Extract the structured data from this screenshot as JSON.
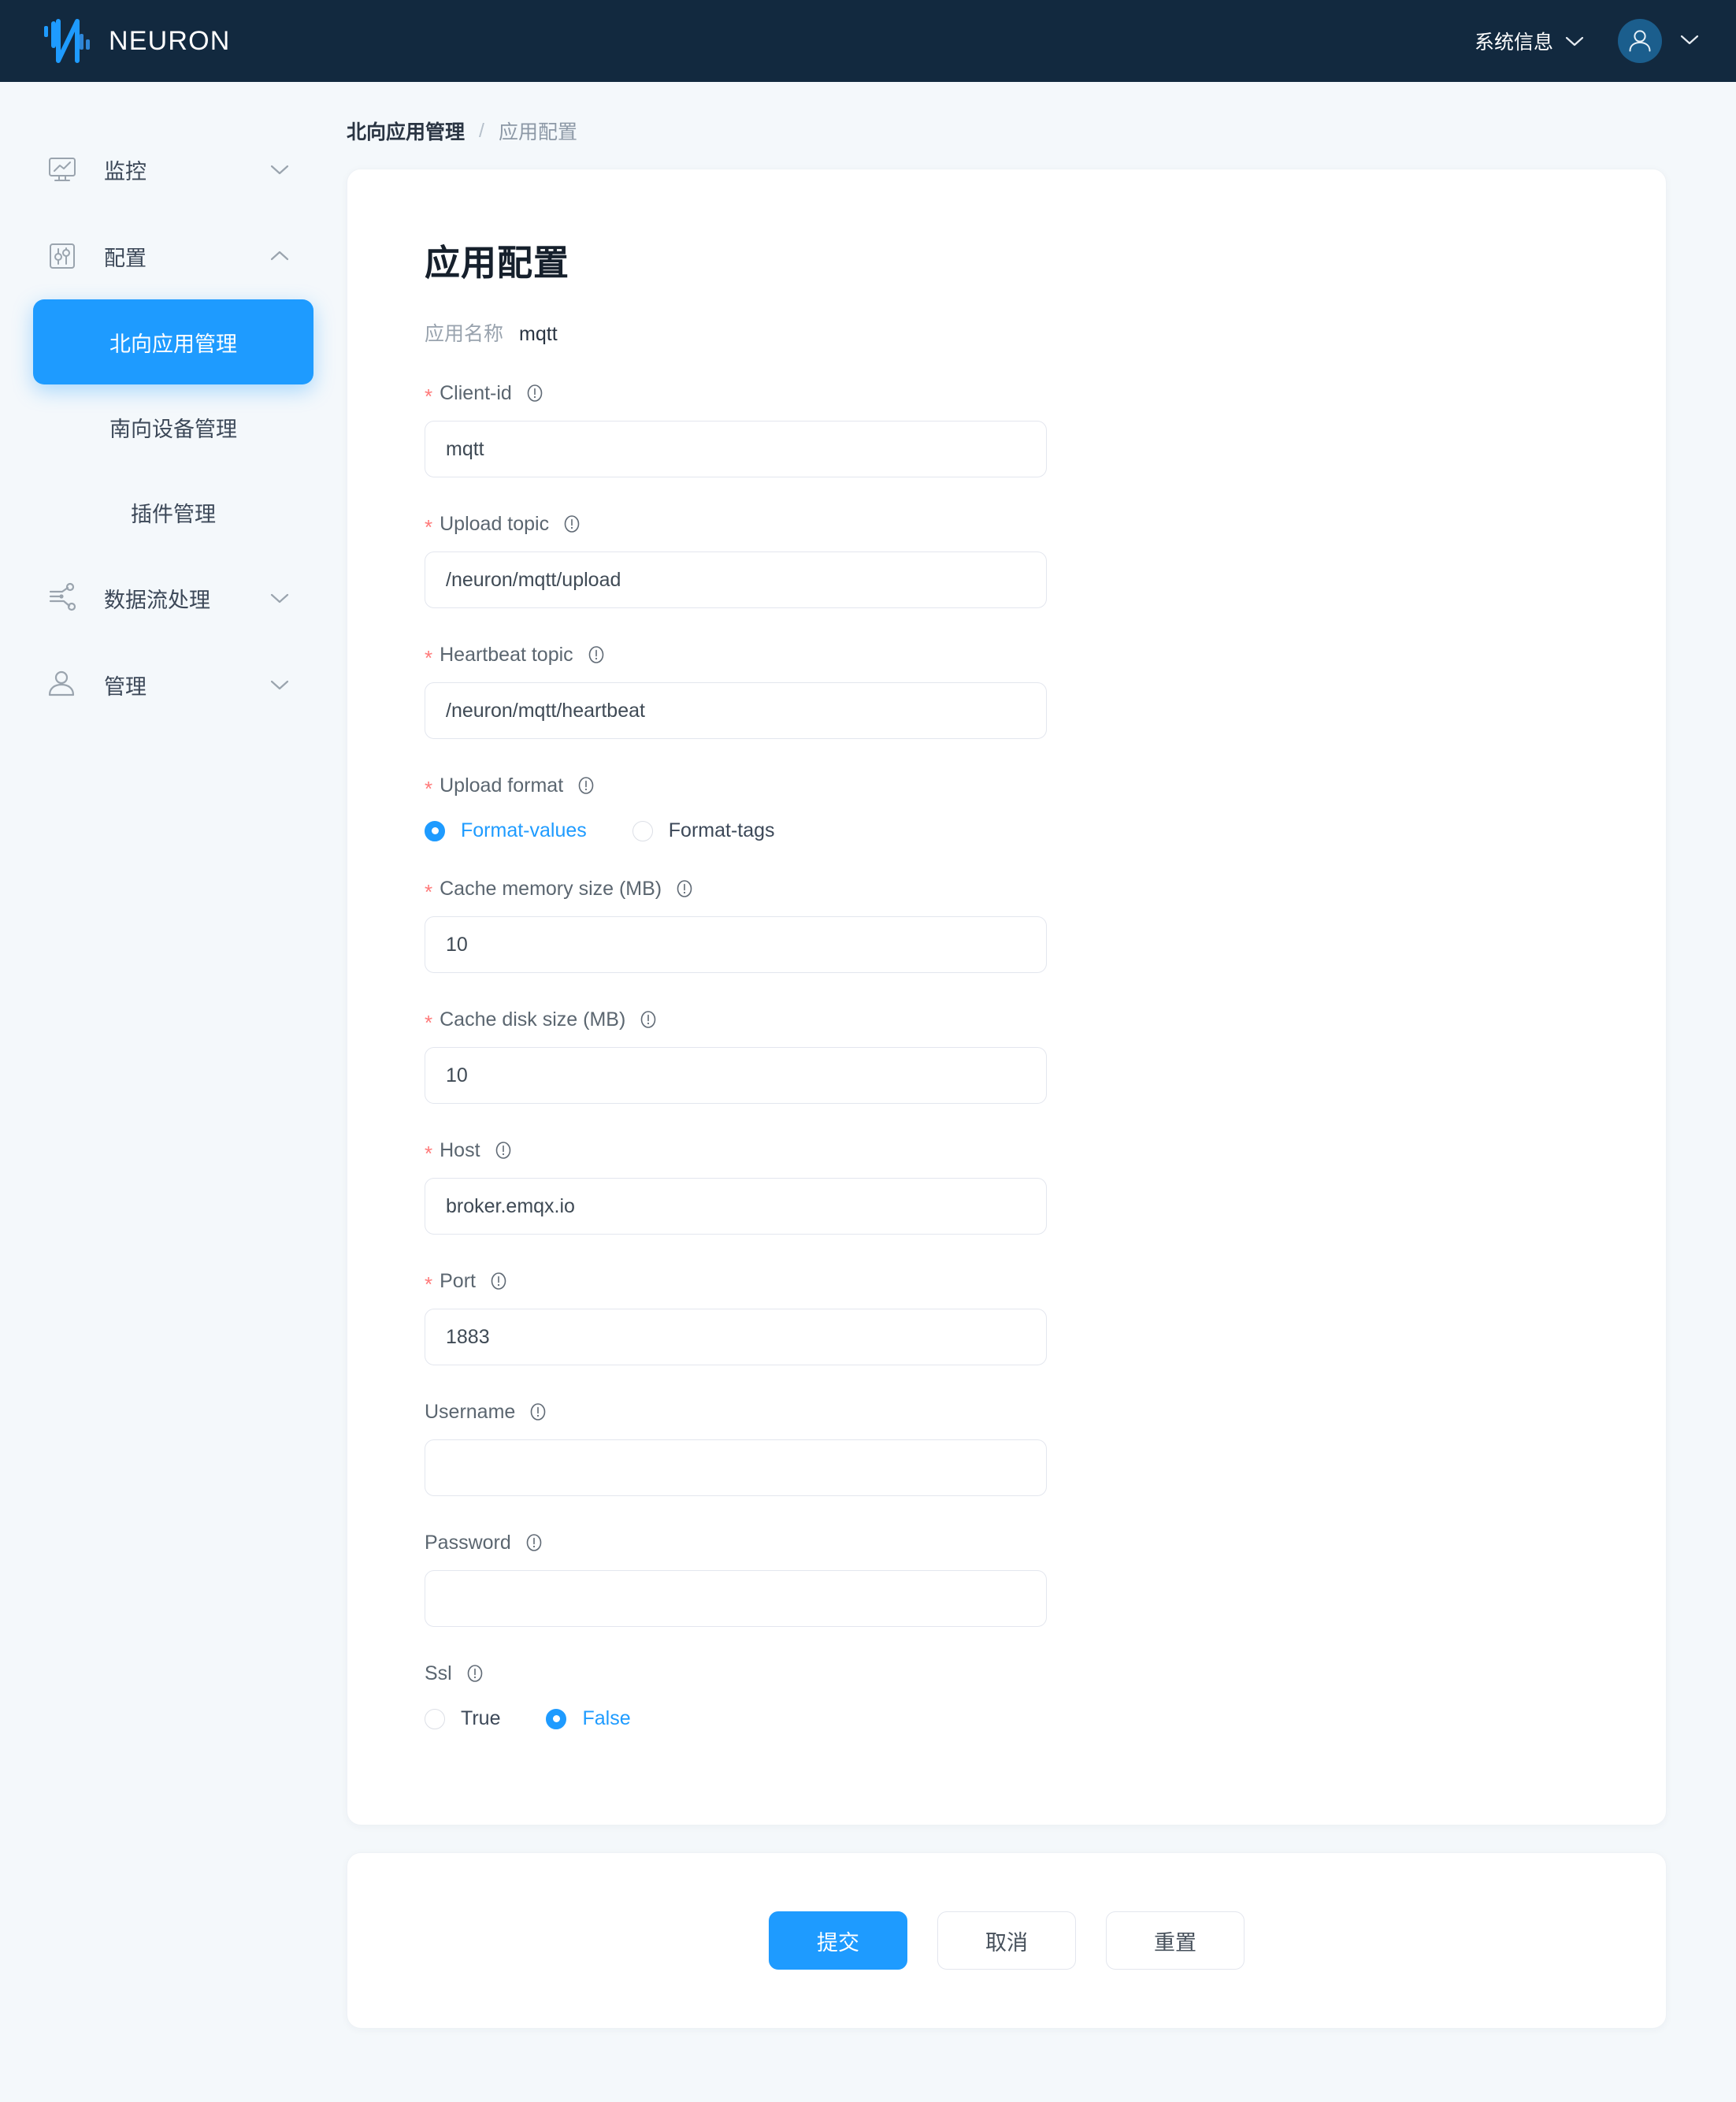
{
  "header": {
    "brand": "NEURON",
    "logo_icon": "neuron-logo-icon",
    "system_info_label": "系统信息",
    "system_info_caret_icon": "chevron-down-icon",
    "avatar_icon": "user-avatar-icon",
    "avatar_caret_icon": "chevron-down-icon"
  },
  "sidebar": {
    "groups": [
      {
        "label": "监控",
        "icon": "monitor-chart-icon",
        "caret": "chevron-down-icon",
        "expanded": false,
        "items": []
      },
      {
        "label": "配置",
        "icon": "sliders-settings-icon",
        "caret": "chevron-up-icon",
        "expanded": true,
        "items": [
          {
            "label": "北向应用管理",
            "active": true
          },
          {
            "label": "南向设备管理",
            "active": false
          },
          {
            "label": "插件管理",
            "active": false
          }
        ]
      },
      {
        "label": "数据流处理",
        "icon": "data-flow-icon",
        "caret": "chevron-down-icon",
        "expanded": false,
        "items": []
      },
      {
        "label": "管理",
        "icon": "user-person-icon",
        "caret": "chevron-down-icon",
        "expanded": false,
        "items": []
      }
    ]
  },
  "breadcrumb": {
    "parent": "北向应用管理",
    "separator": "/",
    "current": "应用配置"
  },
  "main": {
    "page_title": "应用配置",
    "app_name_label": "应用名称",
    "app_name_value": "mqtt",
    "fields": [
      {
        "key": "client_id",
        "label": "Client-id",
        "required": true,
        "type": "text",
        "value": "mqtt",
        "placeholder": "",
        "info_icon": "info-circle-icon"
      },
      {
        "key": "upload_topic",
        "label": "Upload topic",
        "required": true,
        "type": "text",
        "value": "/neuron/mqtt/upload",
        "placeholder": "",
        "info_icon": "info-circle-icon"
      },
      {
        "key": "heartbeat_topic",
        "label": "Heartbeat topic",
        "required": true,
        "type": "text",
        "value": "/neuron/mqtt/heartbeat",
        "placeholder": "",
        "info_icon": "info-circle-icon"
      },
      {
        "key": "upload_format",
        "label": "Upload format",
        "required": true,
        "type": "radio",
        "info_icon": "info-circle-icon",
        "options": [
          {
            "label": "Format-values",
            "selected": true
          },
          {
            "label": "Format-tags",
            "selected": false
          }
        ]
      },
      {
        "key": "cache_memory_size",
        "label": "Cache memory size (MB)",
        "required": true,
        "type": "text",
        "value": "10",
        "placeholder": "",
        "info_icon": "info-circle-icon"
      },
      {
        "key": "cache_disk_size",
        "label": "Cache disk size (MB)",
        "required": true,
        "type": "text",
        "value": "10",
        "placeholder": "",
        "info_icon": "info-circle-icon"
      },
      {
        "key": "host",
        "label": "Host",
        "required": true,
        "type": "text",
        "value": "broker.emqx.io",
        "placeholder": "",
        "info_icon": "info-circle-icon"
      },
      {
        "key": "port",
        "label": "Port",
        "required": true,
        "type": "text",
        "value": "1883",
        "placeholder": "",
        "info_icon": "info-circle-icon"
      },
      {
        "key": "username",
        "label": "Username",
        "required": false,
        "type": "text",
        "value": "",
        "placeholder": "",
        "info_icon": "info-circle-icon"
      },
      {
        "key": "password",
        "label": "Password",
        "required": false,
        "type": "password",
        "value": "",
        "placeholder": "",
        "info_icon": "info-circle-icon"
      },
      {
        "key": "ssl",
        "label": "Ssl",
        "required": false,
        "type": "radio",
        "info_icon": "info-circle-icon",
        "options": [
          {
            "label": "True",
            "selected": false
          },
          {
            "label": "False",
            "selected": true
          }
        ]
      }
    ]
  },
  "footer": {
    "buttons": [
      {
        "label": "提交",
        "primary": true
      },
      {
        "label": "取消",
        "primary": false
      },
      {
        "label": "重置",
        "primary": false
      }
    ]
  },
  "colors": {
    "brand_dark": "#12293f",
    "accent": "#1e9bff",
    "page_bg": "#f4f8fb",
    "required_star": "#ff7a7a"
  }
}
